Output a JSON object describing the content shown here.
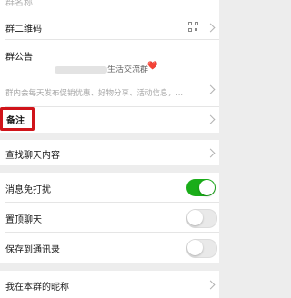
{
  "top_partial_label": "群名称",
  "qr_row": {
    "label": "群二维码",
    "icon": "qr-code-icon"
  },
  "announcement": {
    "label": "群公告",
    "name_suffix": "生活交流群",
    "heart": "❤️",
    "body": "群内会每天发布促销优惠、好物分享、活动信息，..."
  },
  "remark_row": {
    "label": "备注",
    "highlight_color": "#d0141a"
  },
  "search_chat_row": {
    "label": "查找聊天内容"
  },
  "toggles": [
    {
      "label": "消息免打扰",
      "state": "on"
    },
    {
      "label": "置顶聊天",
      "state": "off"
    },
    {
      "label": "保存到通讯录",
      "state": "off"
    }
  ],
  "nickname_row": {
    "label": "我在本群的昵称"
  },
  "colors": {
    "toggle_on": "#1aad19",
    "page_bg": "#ededed"
  }
}
